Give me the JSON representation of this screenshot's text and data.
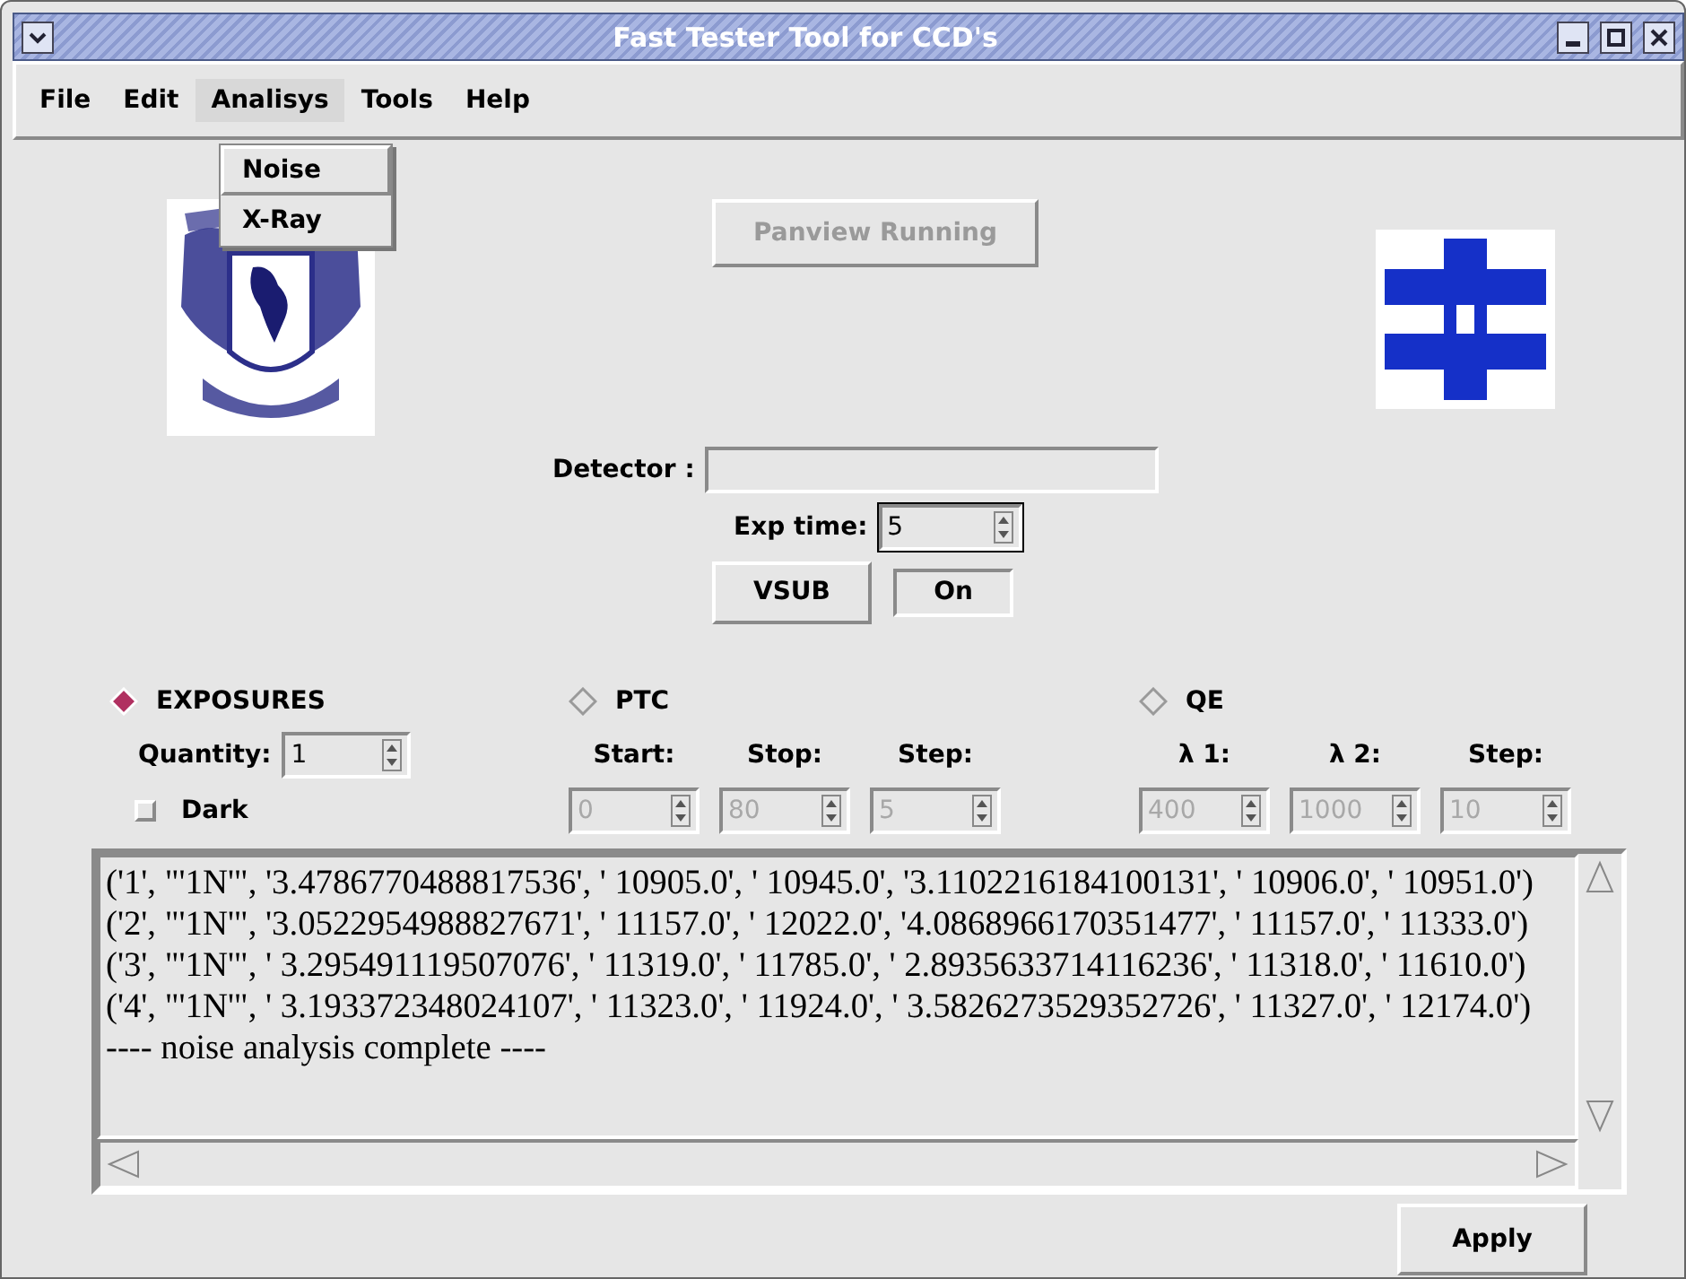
{
  "window": {
    "title": "Fast Tester Tool for CCD's"
  },
  "menu": [
    {
      "label": "File",
      "expanded": false
    },
    {
      "label": "Edit",
      "expanded": false
    },
    {
      "label": "Analisys",
      "expanded": true
    },
    {
      "label": "Tools",
      "expanded": false
    },
    {
      "label": "Help",
      "expanded": false
    }
  ],
  "dropdown": [
    {
      "label": "Noise",
      "selected": true
    },
    {
      "label": "X-Ray",
      "selected": false
    }
  ],
  "panview_button": {
    "label": "Panview Running",
    "disabled": true
  },
  "detector": {
    "label": "Detector :"
  },
  "exp_time": {
    "label": "Exp time:",
    "value": "5"
  },
  "vsub_button": {
    "label": "VSUB"
  },
  "vsub_state": {
    "label": "On"
  },
  "modes": [
    {
      "label": "EXPOSURES",
      "selected": true
    },
    {
      "label": "PTC",
      "selected": false
    },
    {
      "label": "QE",
      "selected": false
    }
  ],
  "quantity": {
    "label": "Quantity:",
    "value": "1"
  },
  "dark": {
    "label": "Dark",
    "checked": false
  },
  "ptc_fields": [
    {
      "label": "Start:",
      "value": "0",
      "disabled": true
    },
    {
      "label": "Stop:",
      "value": "80",
      "disabled": true
    },
    {
      "label": "Step:",
      "value": "5",
      "disabled": true
    }
  ],
  "qe_fields": [
    {
      "label": "λ 1:",
      "value": "400",
      "disabled": true
    },
    {
      "label": "λ 2:",
      "value": "1000",
      "disabled": true
    },
    {
      "label": "Step:",
      "value": "10",
      "disabled": true
    }
  ],
  "log": [
    "('1', \"'1N'\", '3.4786770488817536', ' 10905.0', ' 10945.0', '3.1102216184100131', ' 10906.0', ' 10951.0')",
    "('2', \"'1N'\", '3.0522954988827671', ' 11157.0', ' 12022.0', '4.0868966170351477', ' 11157.0', ' 11333.0')",
    "('3', \"'1N'\", ' 3.295491119507076', ' 11319.0', ' 11785.0', ' 2.8935633714116236', ' 11318.0', ' 11610.0')",
    "('4', \"'1N'\", ' 3.193372348024107', ' 11323.0', ' 11924.0', ' 3.5826273529352726', ' 11327.0', ' 12174.0')",
    "---- noise analysis complete ----"
  ],
  "apply_button": {
    "label": "Apply"
  }
}
